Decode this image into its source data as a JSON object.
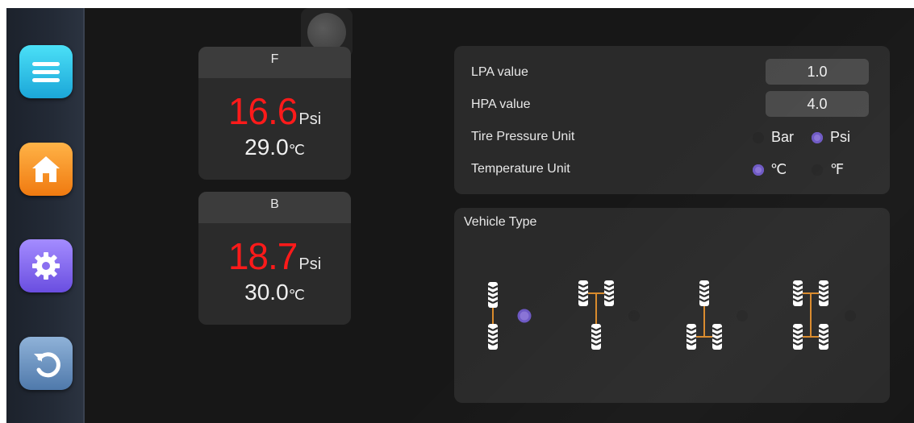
{
  "sidebar": {
    "items": [
      {
        "name": "menu",
        "icon": "menu-icon",
        "color": "#1ba6d8"
      },
      {
        "name": "home",
        "icon": "home-icon",
        "color": "#f07a10"
      },
      {
        "name": "settings",
        "icon": "gear-icon",
        "color": "#6a4ee0"
      },
      {
        "name": "back",
        "icon": "back-arrow-icon",
        "color": "#4f79ab"
      }
    ]
  },
  "tires": {
    "front": {
      "label": "F",
      "pressure": "16.6",
      "pressure_unit": "Psi",
      "temperature": "29.0",
      "temperature_unit": "℃"
    },
    "back": {
      "label": "B",
      "pressure": "18.7",
      "pressure_unit": "Psi",
      "temperature": "30.0",
      "temperature_unit": "℃"
    }
  },
  "settings": {
    "lpa_label": "LPA value",
    "lpa_value": "1.0",
    "hpa_label": "HPA value",
    "hpa_value": "4.0",
    "pressure_unit_label": "Tire Pressure Unit",
    "pressure_unit_options": [
      "Bar",
      "Psi"
    ],
    "pressure_unit_selected": "Psi",
    "temperature_unit_label": "Temperature Unit",
    "temperature_unit_options": [
      "℃",
      "℉"
    ],
    "temperature_unit_selected": "℃"
  },
  "vehicle": {
    "title": "Vehicle Type",
    "types": [
      "2-wheel-inline",
      "3-wheel-front-dual",
      "3-wheel-rear-dual",
      "4-wheel"
    ],
    "selected_index": 0
  },
  "colors": {
    "alarm_red": "#ff1a1a",
    "accent_purple": "#8a74d6",
    "axle_orange": "#d98a2b"
  }
}
